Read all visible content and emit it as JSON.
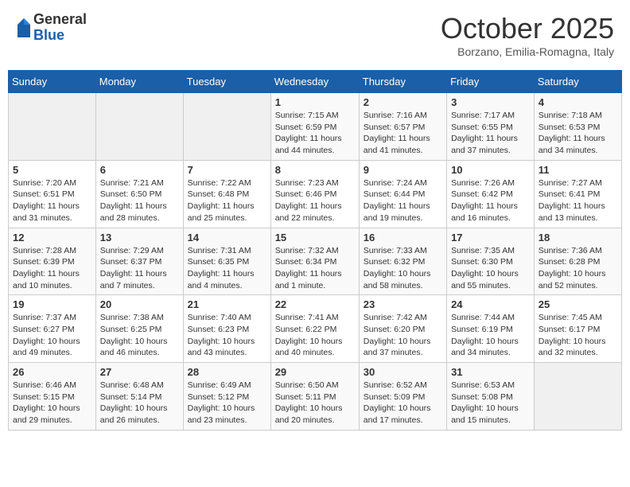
{
  "header": {
    "logo_general": "General",
    "logo_blue": "Blue",
    "month_title": "October 2025",
    "subtitle": "Borzano, Emilia-Romagna, Italy"
  },
  "days_of_week": [
    "Sunday",
    "Monday",
    "Tuesday",
    "Wednesday",
    "Thursday",
    "Friday",
    "Saturday"
  ],
  "weeks": [
    [
      {
        "day": "",
        "sunrise": "",
        "sunset": "",
        "daylight": ""
      },
      {
        "day": "",
        "sunrise": "",
        "sunset": "",
        "daylight": ""
      },
      {
        "day": "",
        "sunrise": "",
        "sunset": "",
        "daylight": ""
      },
      {
        "day": "1",
        "sunrise": "Sunrise: 7:15 AM",
        "sunset": "Sunset: 6:59 PM",
        "daylight": "Daylight: 11 hours and 44 minutes."
      },
      {
        "day": "2",
        "sunrise": "Sunrise: 7:16 AM",
        "sunset": "Sunset: 6:57 PM",
        "daylight": "Daylight: 11 hours and 41 minutes."
      },
      {
        "day": "3",
        "sunrise": "Sunrise: 7:17 AM",
        "sunset": "Sunset: 6:55 PM",
        "daylight": "Daylight: 11 hours and 37 minutes."
      },
      {
        "day": "4",
        "sunrise": "Sunrise: 7:18 AM",
        "sunset": "Sunset: 6:53 PM",
        "daylight": "Daylight: 11 hours and 34 minutes."
      }
    ],
    [
      {
        "day": "5",
        "sunrise": "Sunrise: 7:20 AM",
        "sunset": "Sunset: 6:51 PM",
        "daylight": "Daylight: 11 hours and 31 minutes."
      },
      {
        "day": "6",
        "sunrise": "Sunrise: 7:21 AM",
        "sunset": "Sunset: 6:50 PM",
        "daylight": "Daylight: 11 hours and 28 minutes."
      },
      {
        "day": "7",
        "sunrise": "Sunrise: 7:22 AM",
        "sunset": "Sunset: 6:48 PM",
        "daylight": "Daylight: 11 hours and 25 minutes."
      },
      {
        "day": "8",
        "sunrise": "Sunrise: 7:23 AM",
        "sunset": "Sunset: 6:46 PM",
        "daylight": "Daylight: 11 hours and 22 minutes."
      },
      {
        "day": "9",
        "sunrise": "Sunrise: 7:24 AM",
        "sunset": "Sunset: 6:44 PM",
        "daylight": "Daylight: 11 hours and 19 minutes."
      },
      {
        "day": "10",
        "sunrise": "Sunrise: 7:26 AM",
        "sunset": "Sunset: 6:42 PM",
        "daylight": "Daylight: 11 hours and 16 minutes."
      },
      {
        "day": "11",
        "sunrise": "Sunrise: 7:27 AM",
        "sunset": "Sunset: 6:41 PM",
        "daylight": "Daylight: 11 hours and 13 minutes."
      }
    ],
    [
      {
        "day": "12",
        "sunrise": "Sunrise: 7:28 AM",
        "sunset": "Sunset: 6:39 PM",
        "daylight": "Daylight: 11 hours and 10 minutes."
      },
      {
        "day": "13",
        "sunrise": "Sunrise: 7:29 AM",
        "sunset": "Sunset: 6:37 PM",
        "daylight": "Daylight: 11 hours and 7 minutes."
      },
      {
        "day": "14",
        "sunrise": "Sunrise: 7:31 AM",
        "sunset": "Sunset: 6:35 PM",
        "daylight": "Daylight: 11 hours and 4 minutes."
      },
      {
        "day": "15",
        "sunrise": "Sunrise: 7:32 AM",
        "sunset": "Sunset: 6:34 PM",
        "daylight": "Daylight: 11 hours and 1 minute."
      },
      {
        "day": "16",
        "sunrise": "Sunrise: 7:33 AM",
        "sunset": "Sunset: 6:32 PM",
        "daylight": "Daylight: 10 hours and 58 minutes."
      },
      {
        "day": "17",
        "sunrise": "Sunrise: 7:35 AM",
        "sunset": "Sunset: 6:30 PM",
        "daylight": "Daylight: 10 hours and 55 minutes."
      },
      {
        "day": "18",
        "sunrise": "Sunrise: 7:36 AM",
        "sunset": "Sunset: 6:28 PM",
        "daylight": "Daylight: 10 hours and 52 minutes."
      }
    ],
    [
      {
        "day": "19",
        "sunrise": "Sunrise: 7:37 AM",
        "sunset": "Sunset: 6:27 PM",
        "daylight": "Daylight: 10 hours and 49 minutes."
      },
      {
        "day": "20",
        "sunrise": "Sunrise: 7:38 AM",
        "sunset": "Sunset: 6:25 PM",
        "daylight": "Daylight: 10 hours and 46 minutes."
      },
      {
        "day": "21",
        "sunrise": "Sunrise: 7:40 AM",
        "sunset": "Sunset: 6:23 PM",
        "daylight": "Daylight: 10 hours and 43 minutes."
      },
      {
        "day": "22",
        "sunrise": "Sunrise: 7:41 AM",
        "sunset": "Sunset: 6:22 PM",
        "daylight": "Daylight: 10 hours and 40 minutes."
      },
      {
        "day": "23",
        "sunrise": "Sunrise: 7:42 AM",
        "sunset": "Sunset: 6:20 PM",
        "daylight": "Daylight: 10 hours and 37 minutes."
      },
      {
        "day": "24",
        "sunrise": "Sunrise: 7:44 AM",
        "sunset": "Sunset: 6:19 PM",
        "daylight": "Daylight: 10 hours and 34 minutes."
      },
      {
        "day": "25",
        "sunrise": "Sunrise: 7:45 AM",
        "sunset": "Sunset: 6:17 PM",
        "daylight": "Daylight: 10 hours and 32 minutes."
      }
    ],
    [
      {
        "day": "26",
        "sunrise": "Sunrise: 6:46 AM",
        "sunset": "Sunset: 5:15 PM",
        "daylight": "Daylight: 10 hours and 29 minutes."
      },
      {
        "day": "27",
        "sunrise": "Sunrise: 6:48 AM",
        "sunset": "Sunset: 5:14 PM",
        "daylight": "Daylight: 10 hours and 26 minutes."
      },
      {
        "day": "28",
        "sunrise": "Sunrise: 6:49 AM",
        "sunset": "Sunset: 5:12 PM",
        "daylight": "Daylight: 10 hours and 23 minutes."
      },
      {
        "day": "29",
        "sunrise": "Sunrise: 6:50 AM",
        "sunset": "Sunset: 5:11 PM",
        "daylight": "Daylight: 10 hours and 20 minutes."
      },
      {
        "day": "30",
        "sunrise": "Sunrise: 6:52 AM",
        "sunset": "Sunset: 5:09 PM",
        "daylight": "Daylight: 10 hours and 17 minutes."
      },
      {
        "day": "31",
        "sunrise": "Sunrise: 6:53 AM",
        "sunset": "Sunset: 5:08 PM",
        "daylight": "Daylight: 10 hours and 15 minutes."
      },
      {
        "day": "",
        "sunrise": "",
        "sunset": "",
        "daylight": ""
      }
    ]
  ]
}
